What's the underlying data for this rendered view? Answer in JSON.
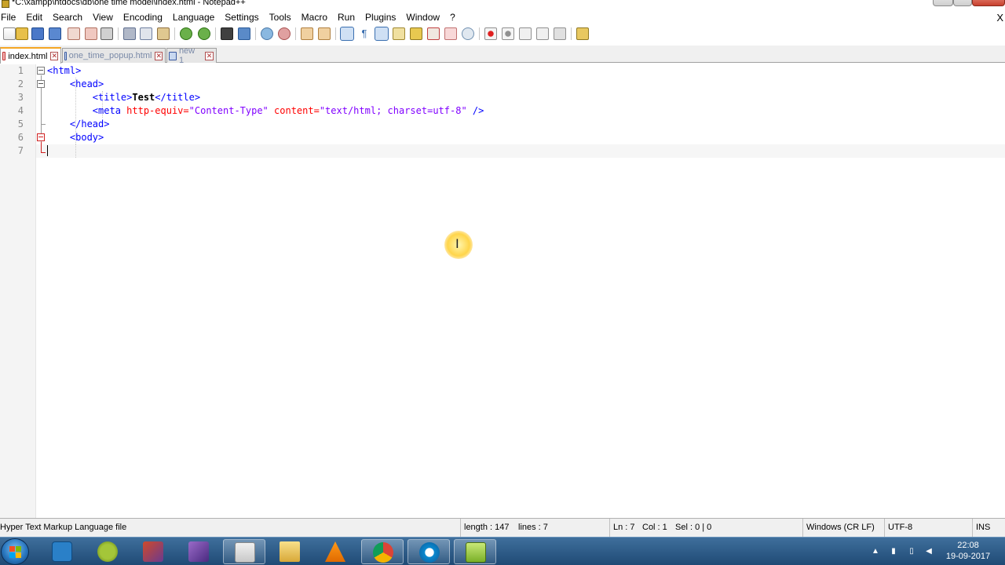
{
  "window": {
    "title": "*C:\\xampp\\htdocs\\db\\one time model\\index.html - Notepad++"
  },
  "menu": {
    "items": [
      "File",
      "Edit",
      "Search",
      "View",
      "Encoding",
      "Language",
      "Settings",
      "Tools",
      "Macro",
      "Run",
      "Plugins",
      "Window",
      "?"
    ],
    "close_glyph": "X"
  },
  "tabs": [
    {
      "label": "index.html",
      "active": true
    },
    {
      "label": "one_time_popup.html",
      "active": false
    },
    {
      "label": "new 1",
      "active": false
    }
  ],
  "editor": {
    "line_numbers": [
      "1",
      "2",
      "3",
      "4",
      "5",
      "6",
      "7"
    ],
    "lines": {
      "l1": {
        "tag": "<html>"
      },
      "l2": {
        "tag": "<head>"
      },
      "l3": {
        "open": "<title>",
        "text": "Test",
        "close": "</title>"
      },
      "l4": {
        "open": "<meta",
        "attr1": "http-equiv=",
        "val1": "\"Content-Type\"",
        "attr2": "content=",
        "val2": "\"text/html; charset=utf-8\"",
        "close": "/>"
      },
      "l5": {
        "tag": "</head>"
      },
      "l6": {
        "tag": "<body>"
      }
    },
    "cursor_glyph": "I"
  },
  "status": {
    "file_type": "Hyper Text Markup Language file",
    "length": "length : 147",
    "lines": "lines : 7",
    "ln": "Ln : 7",
    "col": "Col : 1",
    "sel": "Sel : 0 | 0",
    "eol": "Windows (CR LF)",
    "encoding": "UTF-8",
    "mode": "INS"
  },
  "taskbar": {
    "clock_time": "22:08",
    "clock_date": "19-09-2017",
    "apps": [
      "outlook-icon",
      "android-studio-icon",
      "xampp-icon",
      "adobe-icon",
      "paint-icon",
      "file-explorer-icon",
      "vlc-icon",
      "chrome-icon",
      "hp-icon",
      "notepadpp-icon"
    ]
  }
}
